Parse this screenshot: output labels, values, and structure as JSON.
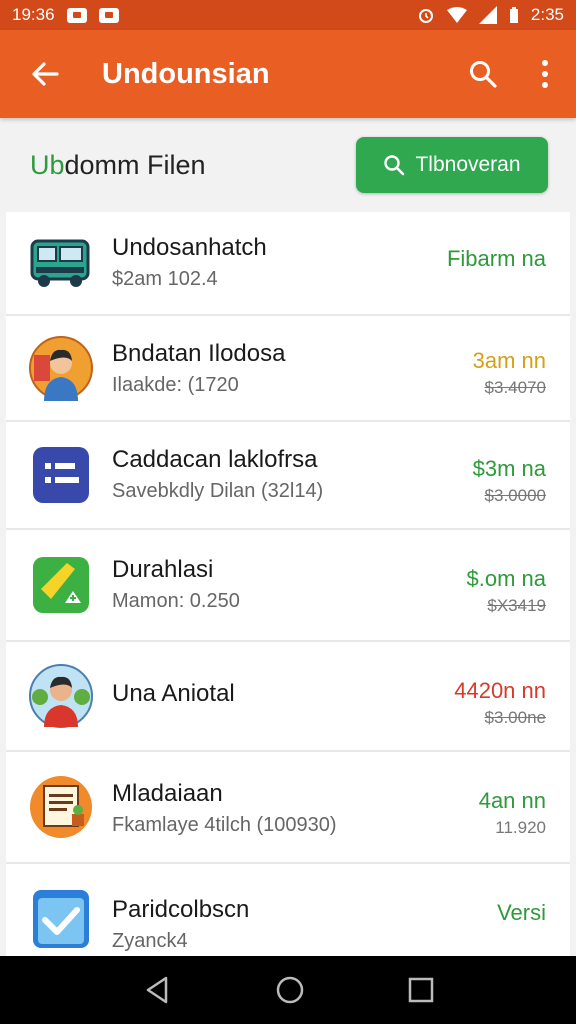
{
  "status": {
    "time_left": "19:36",
    "time_right": "2:35"
  },
  "appbar": {
    "title": "Undounsian",
    "back_icon": "arrow-left-icon",
    "search_icon": "search-icon",
    "menu_icon": "more-vertical-icon",
    "color": "#e95e23"
  },
  "subheader": {
    "title_accent": "Ub",
    "title_rest": "domm Filen",
    "button_label": "Tlbnoveran",
    "button_color": "#2fa84f"
  },
  "items": [
    {
      "title": "Undosanhatch",
      "sub": "$2am 102.4",
      "price": "Fibarm na",
      "price_color": "#2e9a3a",
      "old": "",
      "icon": "bus-icon"
    },
    {
      "title": "Bndatan Ilodosa",
      "sub": "Ilaakde: (1720",
      "price": "3am nn",
      "price_color": "#d4a017",
      "old": "$3.4070",
      "icon": "person-avatar-icon"
    },
    {
      "title": "Caddacan laklofrsa",
      "sub": "Savebkdly Dilan (32l14)",
      "price": "$3m na",
      "price_color": "#2e9a3a",
      "old": "$3.0000",
      "icon": "list-app-icon"
    },
    {
      "title": "Durahlasi",
      "sub": "Mamon: 0.250",
      "price": "$.om na",
      "price_color": "#2e9a3a",
      "old": "$X3419",
      "icon": "edit-app-icon"
    },
    {
      "title": "Una Aniotal",
      "sub": "",
      "price": "4420n nn",
      "price_color": "#d83a2a",
      "old": "$3.00ne",
      "icon": "person-red-avatar-icon"
    },
    {
      "title": "Mladaiaan",
      "sub": "Fkamlaye 4tilch (100930)",
      "price": "4an nn",
      "price_color": "#2e9a3a",
      "old": "11.920",
      "icon": "document-board-icon"
    },
    {
      "title": "Paridcolbscn",
      "sub": "Zyanck4",
      "price": "Versi",
      "price_color": "#2e9a3a",
      "old": "",
      "icon": "checkbox-icon"
    }
  ],
  "navbar": {
    "back_icon": "nav-back-icon",
    "home_icon": "nav-home-icon",
    "recents_icon": "nav-recents-icon"
  }
}
